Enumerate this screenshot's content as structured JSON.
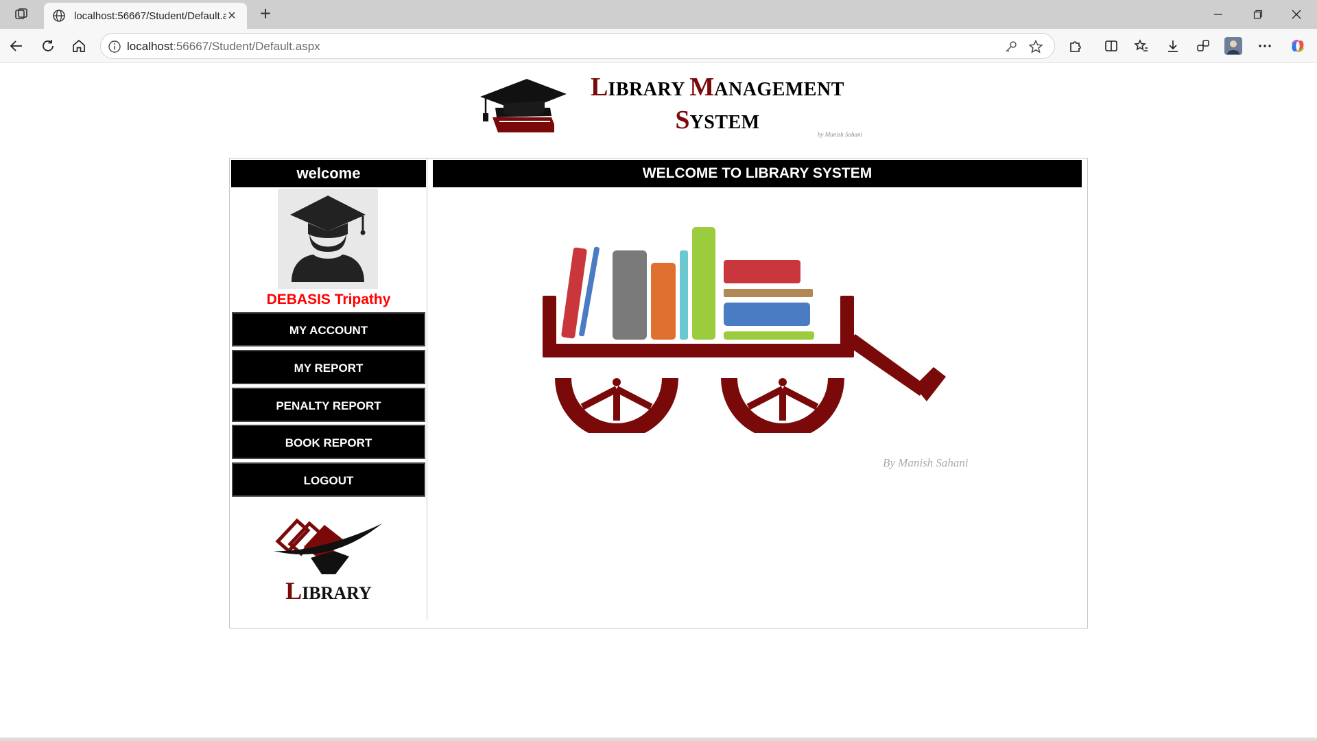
{
  "browser": {
    "tab_title": "localhost:56667/Student/Default.a",
    "url_host": "localhost",
    "url_path": ":56667/Student/Default.aspx"
  },
  "header": {
    "title_line1_cap1": "L",
    "title_line1_rest1": "IBRARY ",
    "title_line1_cap2": "M",
    "title_line1_rest2": "ANAGEMENT",
    "title_line2_cap": "S",
    "title_line2_rest": "YSTEM",
    "byline": "by Manish Sahani"
  },
  "sidebar": {
    "welcome": "welcome",
    "username": "DEBASIS Tripathy",
    "nav": [
      {
        "label": "MY ACCOUNT"
      },
      {
        "label": "MY REPORT"
      },
      {
        "label": "PENALTY REPORT"
      },
      {
        "label": "BOOK REPORT"
      },
      {
        "label": "LOGOUT"
      }
    ],
    "logo_text": "Library"
  },
  "content": {
    "heading": "WELCOME TO LIBRARY SYSTEM",
    "byline": "By Manish Sahani"
  },
  "colors": {
    "accent_dark_red": "#7a0a0a",
    "username_red": "#ff0000",
    "bar_black": "#000000"
  }
}
